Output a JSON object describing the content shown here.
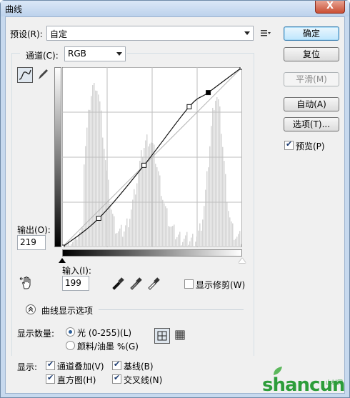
{
  "window": {
    "title": "曲线",
    "close_glyph": "X"
  },
  "preset": {
    "label": "预设(R):",
    "value": "自定"
  },
  "channel": {
    "label": "通道(C):",
    "value": "RGB"
  },
  "buttons": {
    "ok": "确定",
    "reset": "复位",
    "smooth": "平滑(M)",
    "auto": "自动(A)",
    "options": "选项(T)..."
  },
  "preview": {
    "label": "预览(P)",
    "checked": true
  },
  "output": {
    "label": "输出(O):",
    "value": "219"
  },
  "input": {
    "label": "输入(I):",
    "value": "199"
  },
  "show_clipping": {
    "label": "显示修剪(W)",
    "checked": false
  },
  "curve_display_options": {
    "label": "曲线显示选项"
  },
  "show_amount": {
    "label": "显示数量:",
    "light": "光 (0-255)(L)",
    "pigment": "颜料/油墨 %(G)",
    "selected": "light"
  },
  "show": {
    "label": "显示:",
    "channel_overlays": {
      "label": "通道叠加(V)",
      "checked": true
    },
    "baseline": {
      "label": "基线(B)",
      "checked": true
    },
    "histogram": {
      "label": "直方图(H)",
      "checked": true
    },
    "intersection_line": {
      "label": "交叉线(N)",
      "checked": true
    }
  },
  "watermark": {
    "text": "shancun",
    "sub": "山村网"
  },
  "curve_points": [
    [
      0,
      0
    ],
    [
      52,
      41
    ],
    [
      116,
      116
    ],
    [
      180,
      199
    ],
    [
      207,
      219
    ],
    [
      255,
      255
    ]
  ],
  "icons": {
    "curve_tool": "curve-tool-icon",
    "pencil_tool": "pencil-icon",
    "preset_menu": "preset-menu-icon",
    "hand_tool": "on-image-adjust-icon",
    "black_eyedropper": "eyedropper-black-icon",
    "gray_eyedropper": "eyedropper-gray-icon",
    "white_eyedropper": "eyedropper-white-icon",
    "grid_simple": "grid-4x4-icon",
    "grid_detailed": "grid-10x10-icon"
  }
}
